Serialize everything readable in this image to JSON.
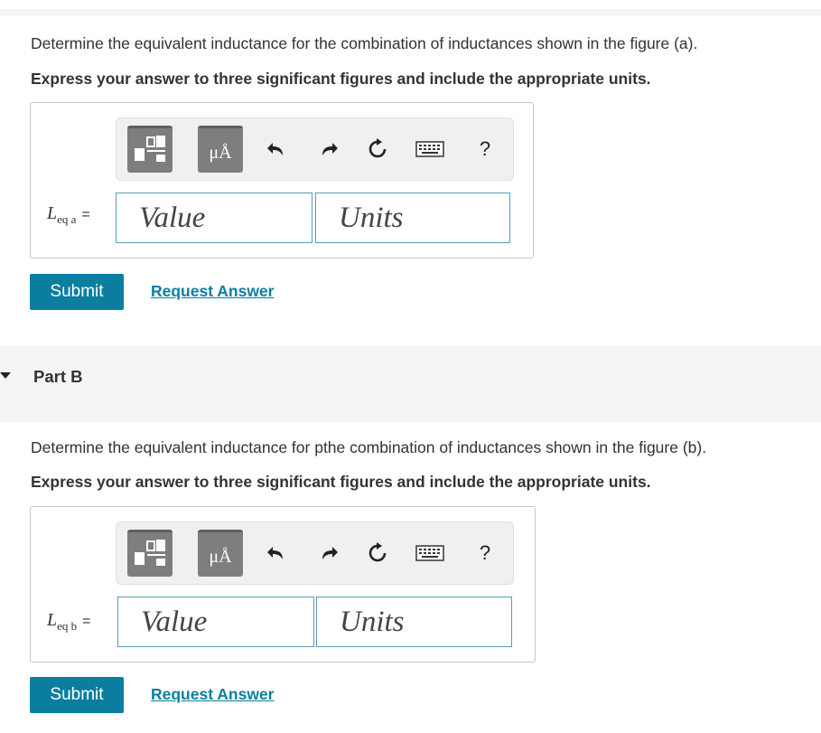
{
  "part_a": {
    "question": "Determine the equivalent inductance for the combination of inductances shown in the figure (a).",
    "instruction": "Express your answer to three significant figures and include the appropriate units.",
    "label_main": "L",
    "label_sub": "eq a",
    "label_eq": "=",
    "value_placeholder": "Value",
    "units_placeholder": "Units",
    "submit_label": "Submit",
    "request_label": "Request Answer"
  },
  "part_b": {
    "header": "Part B",
    "question": "Determine the equivalent inductance for pthe combination of inductances shown in the figure (b).",
    "instruction": "Express your answer to three significant figures and include the appropriate units.",
    "label_main": "L",
    "label_sub": "eq b",
    "label_eq": "=",
    "value_placeholder": "Value",
    "units_placeholder": "Units",
    "submit_label": "Submit",
    "request_label": "Request Answer"
  },
  "toolbar": {
    "units_symbol": "μÅ",
    "help_label": "?",
    "icons": [
      "templates-icon",
      "units-icon",
      "undo-icon",
      "redo-icon",
      "reset-icon",
      "keyboard-icon",
      "help-icon"
    ]
  },
  "colors": {
    "accent": "#0b7ea0",
    "field_border": "#5b9bb3",
    "band": "#f5f5f5"
  }
}
